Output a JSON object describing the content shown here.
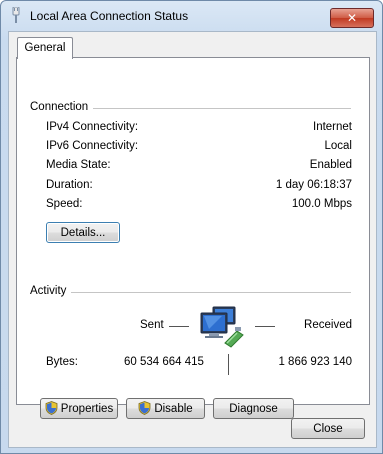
{
  "window": {
    "title": "Local Area Connection Status",
    "close_glyph": "✕"
  },
  "tabs": [
    {
      "label": "General"
    }
  ],
  "connection": {
    "group_label": "Connection",
    "rows": [
      {
        "label": "IPv4 Connectivity:",
        "value": "Internet"
      },
      {
        "label": "IPv6 Connectivity:",
        "value": "Local"
      },
      {
        "label": "Media State:",
        "value": "Enabled"
      },
      {
        "label": "Duration:",
        "value": "1 day 06:18:37"
      },
      {
        "label": "Speed:",
        "value": "100.0 Mbps"
      }
    ],
    "details_label": "Details..."
  },
  "activity": {
    "group_label": "Activity",
    "sent_label": "Sent",
    "received_label": "Received",
    "bytes_label": "Bytes:",
    "bytes_sent": "60 534 664 415",
    "bytes_received": "1 866 923 140"
  },
  "buttons": {
    "properties": "Properties",
    "disable": "Disable",
    "diagnose": "Diagnose",
    "close": "Close"
  },
  "icons": {
    "title": "network-plug-icon",
    "network": "network-computers-icon",
    "shield": "uac-shield-icon"
  }
}
